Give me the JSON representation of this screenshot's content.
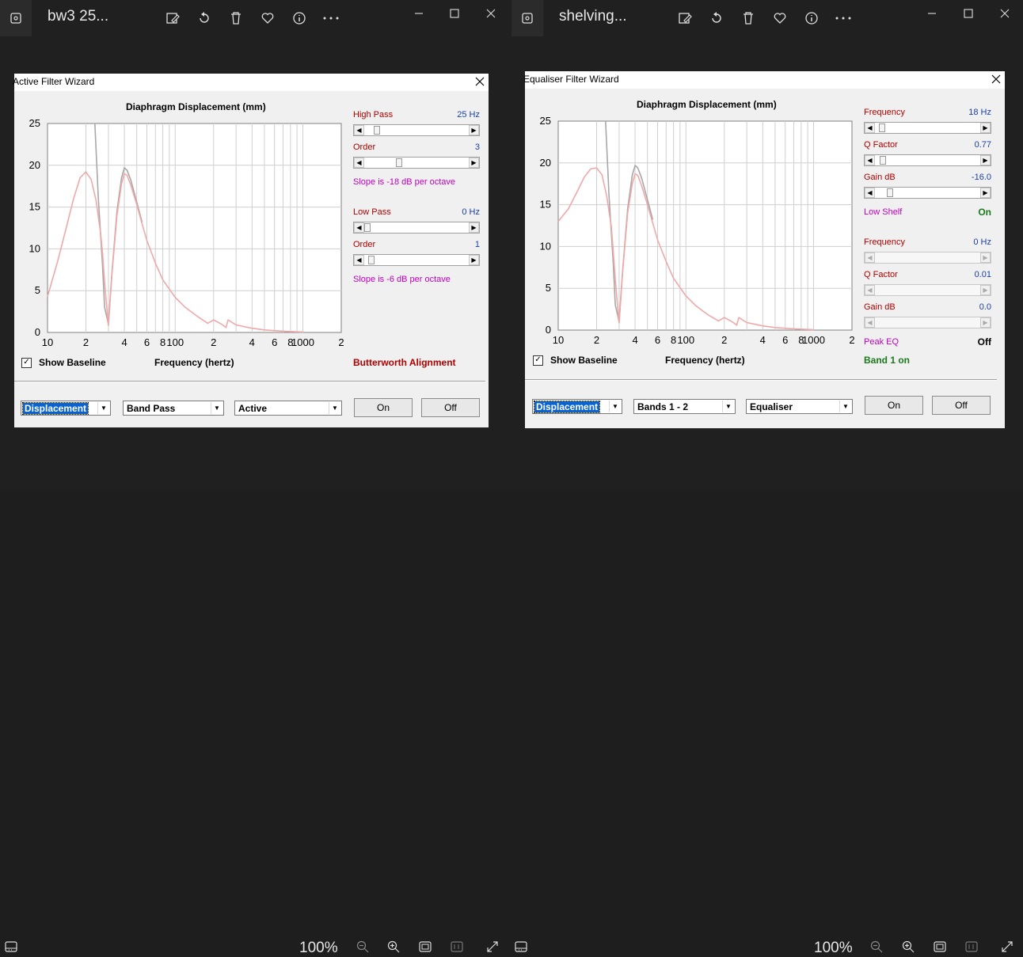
{
  "viewer_left": {
    "title": "bw3 25...",
    "zoom": "100%"
  },
  "viewer_right": {
    "title": "shelving...",
    "zoom": "100%"
  },
  "dialog_left": {
    "title": "Active Filter Wizard",
    "chart_title": "Diaphragm Displacement (mm)",
    "y_ticks": [
      "25",
      "20",
      "15",
      "10",
      "5",
      "0"
    ],
    "x_ticks": [
      "10",
      "2",
      "4",
      "6",
      "8",
      "100",
      "2",
      "4",
      "6",
      "8",
      "1000",
      "2"
    ],
    "high_pass": {
      "label": "High Pass",
      "value": "25 Hz",
      "thumb_pct": 0.1
    },
    "hp_order": {
      "label": "Order",
      "value": "3",
      "thumb_pct": 0.32
    },
    "hp_slope": "Slope is -18 dB per octave",
    "low_pass": {
      "label": "Low Pass",
      "value": "0 Hz",
      "thumb_pct": 0.0
    },
    "lp_order": {
      "label": "Order",
      "value": "1",
      "thumb_pct": 0.04
    },
    "lp_slope": "Slope is -6 dB per octave",
    "show_baseline": "Show Baseline",
    "show_baseline_checked": "✓",
    "xaxis_label": "Frequency (hertz)",
    "alignment": "Butterworth Alignment",
    "combo1": "Displacement",
    "combo2": "Band Pass",
    "combo3": "Active",
    "btn_on": "On",
    "btn_off": "Off"
  },
  "dialog_right": {
    "title": "Equaliser Filter Wizard",
    "chart_title": "Diaphragm Displacement (mm)",
    "y_ticks": [
      "25",
      "20",
      "15",
      "10",
      "5",
      "0"
    ],
    "x_ticks": [
      "10",
      "2",
      "4",
      "6",
      "8",
      "100",
      "2",
      "4",
      "6",
      "8",
      "1000",
      "2"
    ],
    "freq1": {
      "label": "Frequency",
      "value": "18 Hz",
      "thumb_pct": 0.04
    },
    "q1": {
      "label": "Q Factor",
      "value": "0.77",
      "thumb_pct": 0.05
    },
    "gain1": {
      "label": "Gain  dB",
      "value": "-16.0",
      "thumb_pct": 0.12
    },
    "low_shelf": {
      "label": "Low Shelf",
      "value": "On"
    },
    "freq2": {
      "label": "Frequency",
      "value": "0 Hz"
    },
    "q2": {
      "label": "Q Factor",
      "value": "0.01"
    },
    "gain2": {
      "label": "Gain  dB",
      "value": "0.0"
    },
    "peak_eq": {
      "label": "Peak EQ",
      "value": "Off"
    },
    "band_status": "Band 1 on",
    "show_baseline": "Show Baseline",
    "show_baseline_checked": "✓",
    "xaxis_label": "Frequency (hertz)",
    "combo1": "Displacement",
    "combo2": "Bands 1 - 2",
    "combo3": "Equaliser",
    "btn_on": "On",
    "btn_off": "Off"
  },
  "chart_data": [
    {
      "type": "line",
      "title": "Diaphragm Displacement (mm)",
      "xlabel": "Frequency (hertz)",
      "ylabel": "",
      "xscale": "log",
      "xlim": [
        10,
        2000
      ],
      "ylim": [
        0,
        25
      ],
      "grid": true,
      "series": [
        {
          "color": "#f0a8a8",
          "x": [
            10,
            12,
            14,
            16,
            18,
            20,
            22,
            24,
            26,
            27,
            28,
            30,
            32,
            35,
            38,
            40,
            42,
            45,
            50,
            55,
            60,
            70,
            80,
            100,
            120,
            150,
            180,
            200,
            230,
            250,
            260,
            300,
            400,
            500,
            700,
            900,
            1000
          ],
          "y": [
            4.3,
            8.5,
            12.5,
            16,
            18.5,
            19.2,
            18.3,
            15.8,
            12,
            9.5,
            6,
            0.8,
            7,
            14,
            17.8,
            19,
            18.8,
            17.6,
            15.3,
            13,
            11,
            8.3,
            6.3,
            4.2,
            3,
            1.9,
            1.1,
            1.5,
            1,
            0.6,
            1.5,
            0.9,
            0.5,
            0.3,
            0.15,
            0.08,
            0.05
          ]
        },
        {
          "color": "#a8a8a8",
          "x": [
            23.5,
            25,
            27,
            28,
            30,
            32,
            35,
            38,
            40,
            42,
            45,
            50,
            55
          ],
          "y": [
            25,
            16,
            8,
            3,
            1,
            7.2,
            14.5,
            18.5,
            19.7,
            19.4,
            18.2,
            15.6,
            13.2
          ]
        }
      ]
    },
    {
      "type": "line",
      "title": "Diaphragm Displacement (mm)",
      "xlabel": "Frequency (hertz)",
      "ylabel": "",
      "xscale": "log",
      "xlim": [
        10,
        2000
      ],
      "ylim": [
        0,
        25
      ],
      "grid": true,
      "series": [
        {
          "color": "#f0a8a8",
          "x": [
            10,
            12,
            14,
            16,
            18,
            20,
            22,
            24,
            26,
            27,
            28,
            30,
            32,
            35,
            38,
            40,
            42,
            45,
            50,
            55,
            60,
            70,
            80,
            100,
            120,
            150,
            180,
            200,
            230,
            250,
            260,
            300,
            400,
            500,
            700,
            900,
            1000
          ],
          "y": [
            13,
            14.5,
            16.5,
            18.3,
            19.3,
            19.4,
            18.6,
            16,
            12.5,
            9.5,
            6,
            0.8,
            7,
            14,
            17.5,
            18.7,
            18.5,
            17.3,
            15,
            12.8,
            10.8,
            8.2,
            6.2,
            4.1,
            2.9,
            1.8,
            1.1,
            1.5,
            1,
            0.6,
            1.5,
            0.9,
            0.5,
            0.3,
            0.15,
            0.08,
            0.05
          ]
        },
        {
          "color": "#a8a8a8",
          "x": [
            23.5,
            25,
            27,
            28,
            30,
            32,
            35,
            38,
            40,
            42,
            45,
            50,
            55
          ],
          "y": [
            25,
            16,
            8,
            3,
            1,
            7.2,
            14.5,
            18.5,
            19.7,
            19.4,
            18.2,
            15.6,
            13.2
          ]
        }
      ]
    }
  ]
}
